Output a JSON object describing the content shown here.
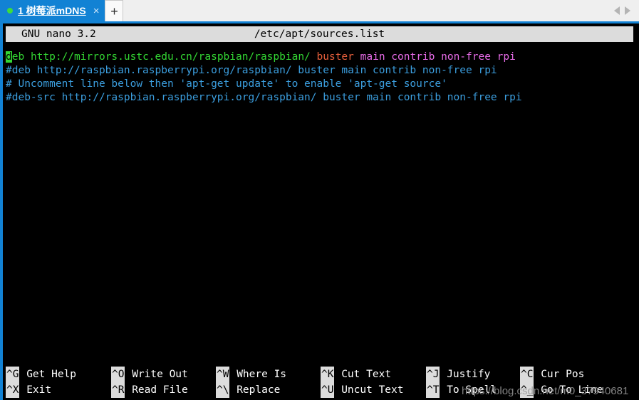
{
  "window": {
    "tab": {
      "status_dot": "green-dot-icon",
      "index": "1",
      "title": "树莓派mDNS",
      "close_label": "×"
    },
    "new_tab_label": "+",
    "nav_prev_icon": "triangle-left-icon",
    "nav_next_icon": "triangle-right-icon"
  },
  "nano": {
    "version": "GNU nano 3.2",
    "filepath": "/etc/apt/sources.list",
    "lines": [
      {
        "id": "line-1",
        "segments": [
          {
            "text": "d",
            "style": "cursor"
          },
          {
            "text": "eb ",
            "style": "green"
          },
          {
            "text": "http://mirrors.ustc.edu.cn/raspbian/raspbian/ ",
            "style": "green"
          },
          {
            "text": "buster ",
            "style": "orange"
          },
          {
            "text": "main contrib non-free rpi",
            "style": "magenta"
          }
        ]
      },
      {
        "id": "line-2",
        "segments": [
          {
            "text": "#deb http://raspbian.raspberrypi.org/raspbian/ buster main contrib non-free rpi",
            "style": "blue"
          }
        ]
      },
      {
        "id": "line-3",
        "segments": [
          {
            "text": "# Uncomment line below then 'apt-get update' to enable 'apt-get source'",
            "style": "blue"
          }
        ]
      },
      {
        "id": "line-4",
        "segments": [
          {
            "text": "#deb-src http://raspbian.raspberrypi.org/raspbian/ buster main contrib non-free rpi",
            "style": "blue"
          }
        ]
      }
    ],
    "shortcuts": [
      [
        {
          "key": "^G",
          "label": "Get Help"
        },
        {
          "key": "^O",
          "label": "Write Out"
        },
        {
          "key": "^W",
          "label": "Where Is"
        },
        {
          "key": "^K",
          "label": "Cut Text"
        },
        {
          "key": "^J",
          "label": "Justify"
        },
        {
          "key": "^C",
          "label": "Cur Pos"
        }
      ],
      [
        {
          "key": "^X",
          "label": "Exit"
        },
        {
          "key": "^R",
          "label": "Read File"
        },
        {
          "key": "^\\",
          "label": "Replace"
        },
        {
          "key": "^U",
          "label": "Uncut Text"
        },
        {
          "key": "^T",
          "label": "To Spell"
        },
        {
          "key": "^_",
          "label": "Go To Line"
        }
      ]
    ]
  },
  "watermark": "https://blog.csdn.net/m0_37940681"
}
